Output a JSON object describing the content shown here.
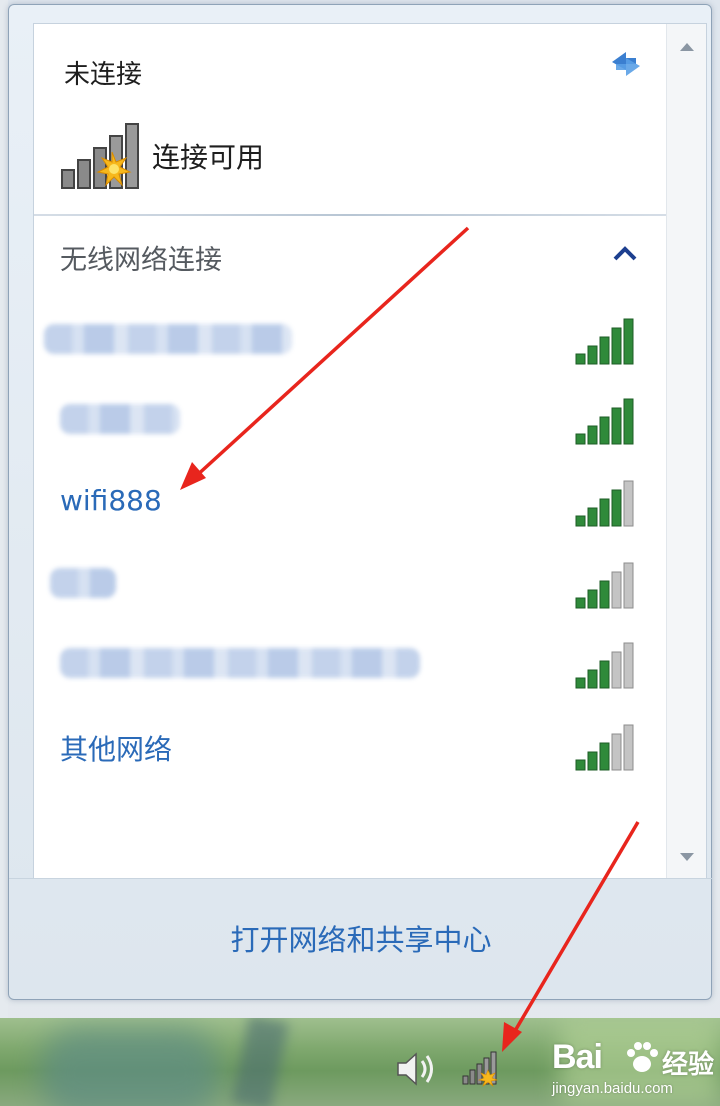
{
  "flyout": {
    "status_title": "未连接",
    "connection_label": "连接可用",
    "section_header": "无线网络连接",
    "networks": [
      {
        "name": "",
        "blurred": true,
        "signal_bars": 5
      },
      {
        "name": "",
        "blurred": true,
        "signal_bars": 5
      },
      {
        "name": "wifi888",
        "blurred": false,
        "signal_bars": 4
      },
      {
        "name": "",
        "blurred": true,
        "signal_bars": 3
      },
      {
        "name": "",
        "blurred": true,
        "signal_bars": 3
      },
      {
        "name": "其他网络",
        "blurred": false,
        "signal_bars": 3
      }
    ],
    "footer_link": "打开网络和共享中心"
  },
  "icons": {
    "refresh": "refresh-icon",
    "connection": "signal-available-icon",
    "collapse": "chevron-up-icon",
    "scroll_up": "scroll-up-icon",
    "scroll_down": "scroll-down-icon",
    "volume": "speaker-icon",
    "tray_network": "network-tray-icon"
  },
  "watermark": {
    "brand": "Bai",
    "brand_suffix": "经验",
    "url": "jingyan.baidu.com"
  },
  "colors": {
    "link": "#2a6ab8",
    "signal_on": "#2f8a3a",
    "signal_off": "#b5b5b5",
    "annotation_arrow": "#e8251d"
  }
}
